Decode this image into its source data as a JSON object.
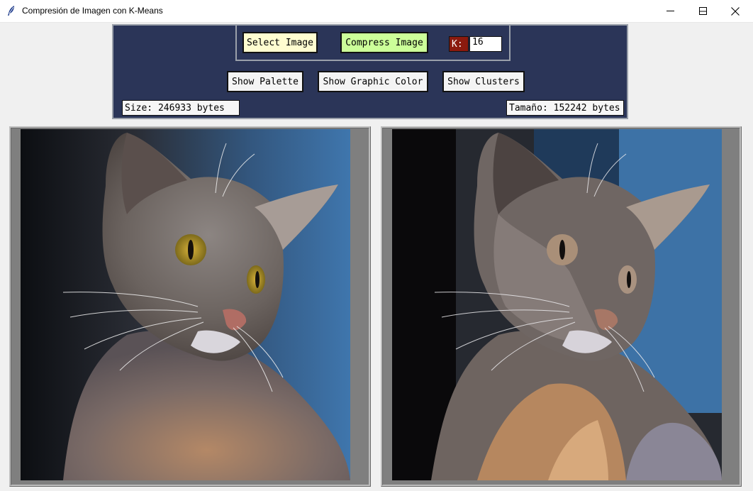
{
  "window": {
    "title": "Compresión de Imagen con K-Means",
    "app_icon": "feather-icon",
    "controls": [
      "minimize-icon",
      "maximize-icon",
      "close-icon"
    ]
  },
  "toolbar": {
    "select_image_label": "Select Image",
    "compress_image_label": "Compress Image",
    "k_label": "K:",
    "k_value": "16",
    "show_palette_label": "Show Palette",
    "show_graphic_color_label": "Show Graphic Color",
    "show_clusters_label": "Show Clusters",
    "original_size_text": "Size: 246933 bytes",
    "compressed_size_text": "Tamaño: 152242 bytes"
  },
  "colors": {
    "panel_bg": "#2b3558",
    "select_button_bg": "#fffdd0",
    "compress_button_bg": "#ccff99",
    "k_label_bg": "#8b1a0e",
    "frame_bg": "#7f7f7f"
  },
  "images": {
    "original_alt": "Original cat photo",
    "compressed_alt": "K-Means compressed cat photo"
  }
}
